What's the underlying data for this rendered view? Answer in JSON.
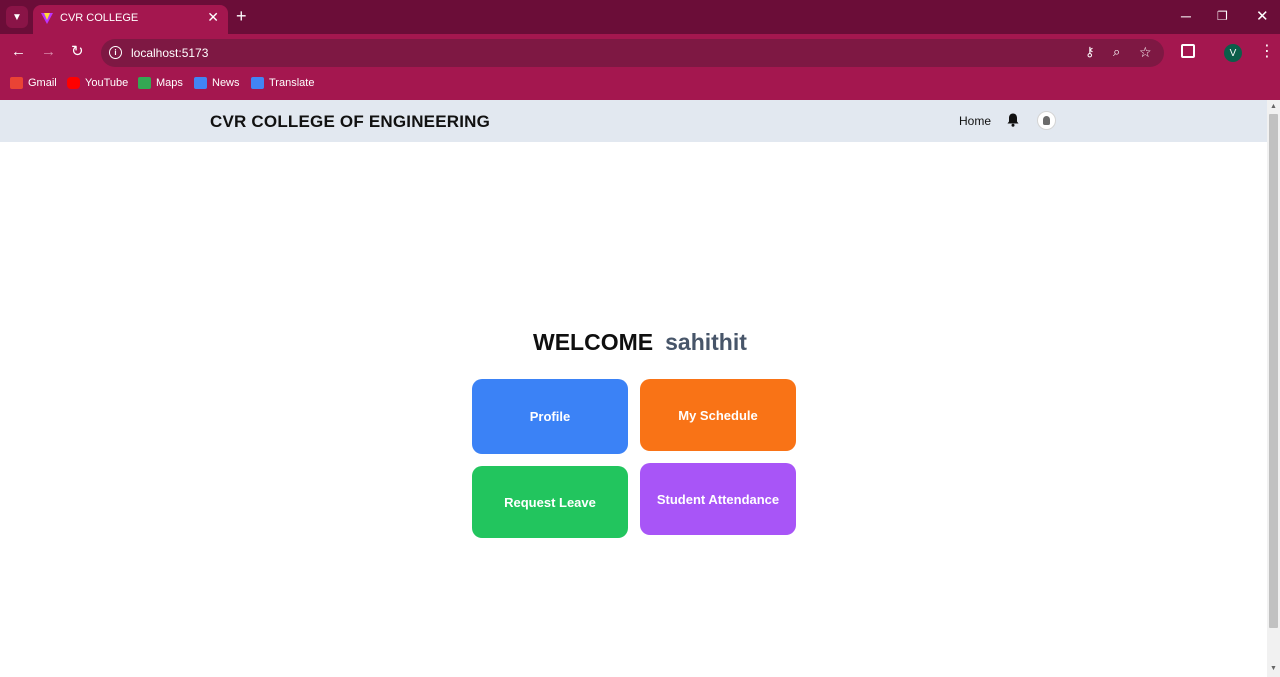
{
  "browser": {
    "tab_title": "CVR COLLEGE",
    "tab_close": "✕",
    "new_tab": "+",
    "url": "localhost:5173",
    "profile_initial": "V",
    "window_controls": {
      "minimize": "─",
      "maximize": "❐",
      "close": "✕"
    },
    "bookmarks": [
      {
        "label": "Gmail",
        "icon": "gmail-icon",
        "color": "#ea4335"
      },
      {
        "label": "YouTube",
        "icon": "youtube-icon",
        "color": "#ff0000"
      },
      {
        "label": "Maps",
        "icon": "maps-icon",
        "color": "#34a853"
      },
      {
        "label": "News",
        "icon": "news-icon",
        "color": "#4285f4"
      },
      {
        "label": "Translate",
        "icon": "translate-icon",
        "color": "#4285f4"
      }
    ],
    "colors": {
      "tabstrip": "#6b0d38",
      "toolbar": "#a4174f",
      "omnibox": "#7e1843"
    }
  },
  "navbar": {
    "brand": "CVR COLLEGE OF ENGINEERING",
    "home_link": "Home",
    "bell_icon": "bell-icon",
    "avatar_icon": "user-avatar-icon"
  },
  "main": {
    "welcome_word": "WELCOME",
    "username": "sahithit",
    "cards": {
      "profile": {
        "label": "Profile",
        "color": "#3b82f6"
      },
      "schedule": {
        "label": "My Schedule",
        "color": "#f97316"
      },
      "leave": {
        "label": "Request Leave",
        "color": "#22c55e"
      },
      "attendance": {
        "label": "Student Attendance",
        "color": "#a855f7"
      }
    }
  }
}
